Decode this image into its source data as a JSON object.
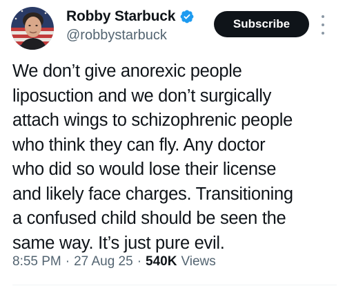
{
  "author": {
    "display_name": "Robby Starbuck",
    "handle": "@robbystarbuck",
    "verified": true,
    "verified_color": "#1d9bf0"
  },
  "actions": {
    "subscribe_label": "Subscribe"
  },
  "tweet": {
    "line_1": "We don’t give anorexic people",
    "line_2": "liposuction and we don’t surgically",
    "line_3": "attach wings to schizophrenic people",
    "line_4": "who think they can fly. Any doctor",
    "line_5": "who did so would lose their license",
    "line_6": "and likely face charges. Transitioning",
    "line_7": "a confused child should be seen the",
    "line_8": "same way. It’s just pure evil."
  },
  "meta": {
    "time": "8:55 PM",
    "separator": "·",
    "date": "27 Aug 25",
    "views_count": "540K",
    "views_label": "Views"
  },
  "icons": {
    "avatar": "profile-photo-icon",
    "verified": "verified-badge-icon",
    "more": "more-options-icon"
  }
}
